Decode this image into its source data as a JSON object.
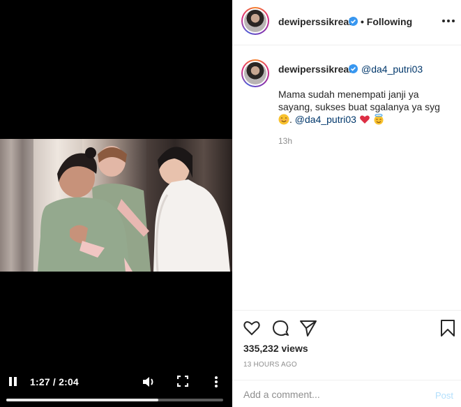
{
  "video": {
    "timecode": "1:27 / 2:04",
    "progress_fraction": 0.7,
    "state": "playing",
    "icons": [
      "pause-icon",
      "volume-icon",
      "fullscreen-icon",
      "more-vertical-icon"
    ]
  },
  "header": {
    "username": "dewiperssikreal",
    "verified": true,
    "separator": "•",
    "follow_label": "Following"
  },
  "caption": {
    "username": "dewiperssikreal",
    "mention_inline": "@da4_putri03",
    "text": "Mama sudah menempati janji ya sayang, sukses buat sgalanya ya syg",
    "mention_second": "@da4_putri03",
    "age": "13h"
  },
  "actions": {
    "icons": [
      "heart-icon",
      "comment-icon",
      "share-icon",
      "bookmark-icon"
    ],
    "views": "335,232 views",
    "time_ago": "13 HOURS AGO"
  },
  "comment": {
    "placeholder": "Add a comment...",
    "post_label": "Post"
  },
  "colors": {
    "link": "#00376b",
    "verified": "#3897f0",
    "post_disabled": "#b2dffc",
    "muted": "#8e8e8e"
  }
}
